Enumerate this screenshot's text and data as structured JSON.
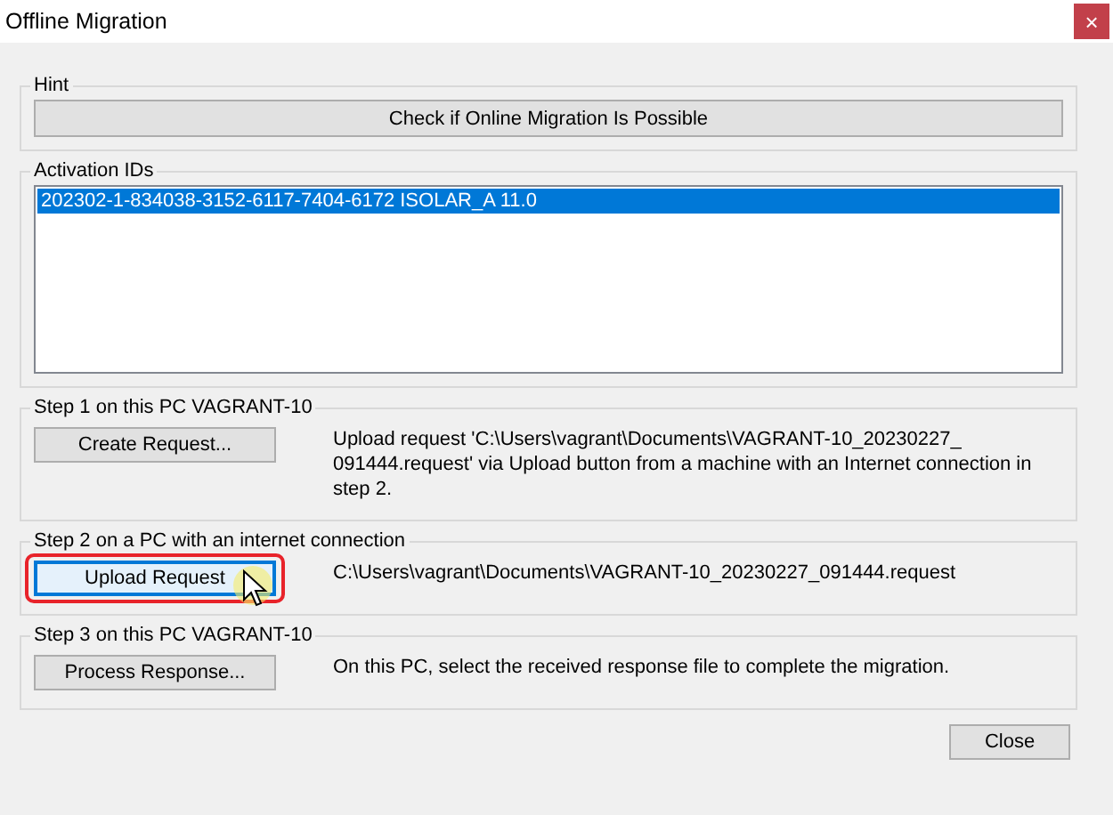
{
  "window": {
    "title": "Offline Migration",
    "close": "×"
  },
  "hint": {
    "legend": "Hint",
    "button": "Check if Online Migration Is Possible"
  },
  "activation": {
    "legend": "Activation IDs",
    "items": [
      {
        "label": "202302-1-834038-3152-6117-7404-6172 ISOLAR_A 11.0",
        "selected": true
      }
    ]
  },
  "steps": [
    {
      "legend": "Step 1 on this PC VAGRANT-10",
      "button": "Create Request...",
      "focused": false,
      "circled": false,
      "pointer": false,
      "text": "Upload request 'C:\\Users\\vagrant\\Documents\\VAGRANT-10_20230227_ 091444.request' via Upload button from a machine with an Internet connection in step 2."
    },
    {
      "legend": "Step 2 on a PC with an internet connection",
      "button": "Upload Request",
      "focused": true,
      "circled": true,
      "pointer": true,
      "text": "C:\\Users\\vagrant\\Documents\\VAGRANT-10_20230227_091444.request"
    },
    {
      "legend": "Step 3 on this PC VAGRANT-10",
      "button": "Process Response...",
      "focused": false,
      "circled": false,
      "pointer": false,
      "text": "On this PC, select the received response file to complete the migration."
    }
  ],
  "buttons": [
    "Close"
  ]
}
